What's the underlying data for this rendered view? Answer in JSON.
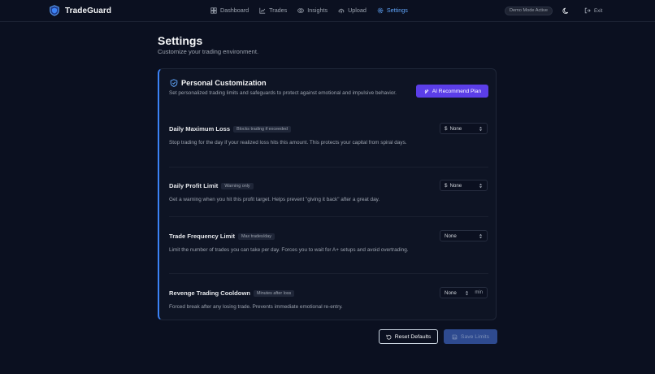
{
  "app": {
    "brand": "TradeGuard",
    "nav": [
      {
        "label": "Dashboard",
        "icon": "dashboard-icon"
      },
      {
        "label": "Trades",
        "icon": "chart-line-icon"
      },
      {
        "label": "Insights",
        "icon": "brain-icon"
      },
      {
        "label": "Upload",
        "icon": "cloud-upload-icon"
      },
      {
        "label": "Settings",
        "icon": "gear-icon",
        "active": true
      }
    ],
    "demo_badge": "Demo Mode Active",
    "exit_label": "Exit"
  },
  "page": {
    "title": "Settings",
    "subtitle": "Customize your trading environment."
  },
  "card": {
    "title": "Personal Customization",
    "description": "Set personalized trading limits and safeguards to protect against emotional and impulsive behavior.",
    "ai_button": "AI Recommend Plan"
  },
  "settings": [
    {
      "name": "Daily Maximum Loss",
      "badge": "Blocks trading if exceeded",
      "description": "Stop trading for the day if your realized loss hits this amount. This protects your capital from spiral days.",
      "prefix": "$",
      "value_placeholder": "None"
    },
    {
      "name": "Daily Profit Limit",
      "badge": "Warning only",
      "description": "Get a warning when you hit this profit target. Helps prevent \"giving it back\" after a great day.",
      "prefix": "$",
      "value_placeholder": "None"
    },
    {
      "name": "Trade Frequency Limit",
      "badge": "Max trades/day",
      "description": "Limit the number of trades you can take per day. Forces you to wait for A+ setups and avoid overtrading.",
      "prefix": "",
      "value_placeholder": "None"
    },
    {
      "name": "Revenge Trading Cooldown",
      "badge": "Minutes after loss",
      "description": "Forced break after any losing trade. Prevents immediate emotional re-entry.",
      "prefix": "",
      "value_placeholder": "None",
      "unit": "min"
    }
  ],
  "actions": {
    "reset": "Reset Defaults",
    "save": "Save Limits"
  },
  "colors": {
    "background": "#0b1020",
    "accent": "#3b82f6",
    "ai_button": "#5b3ee8",
    "save_disabled": "#2e4a8f"
  }
}
